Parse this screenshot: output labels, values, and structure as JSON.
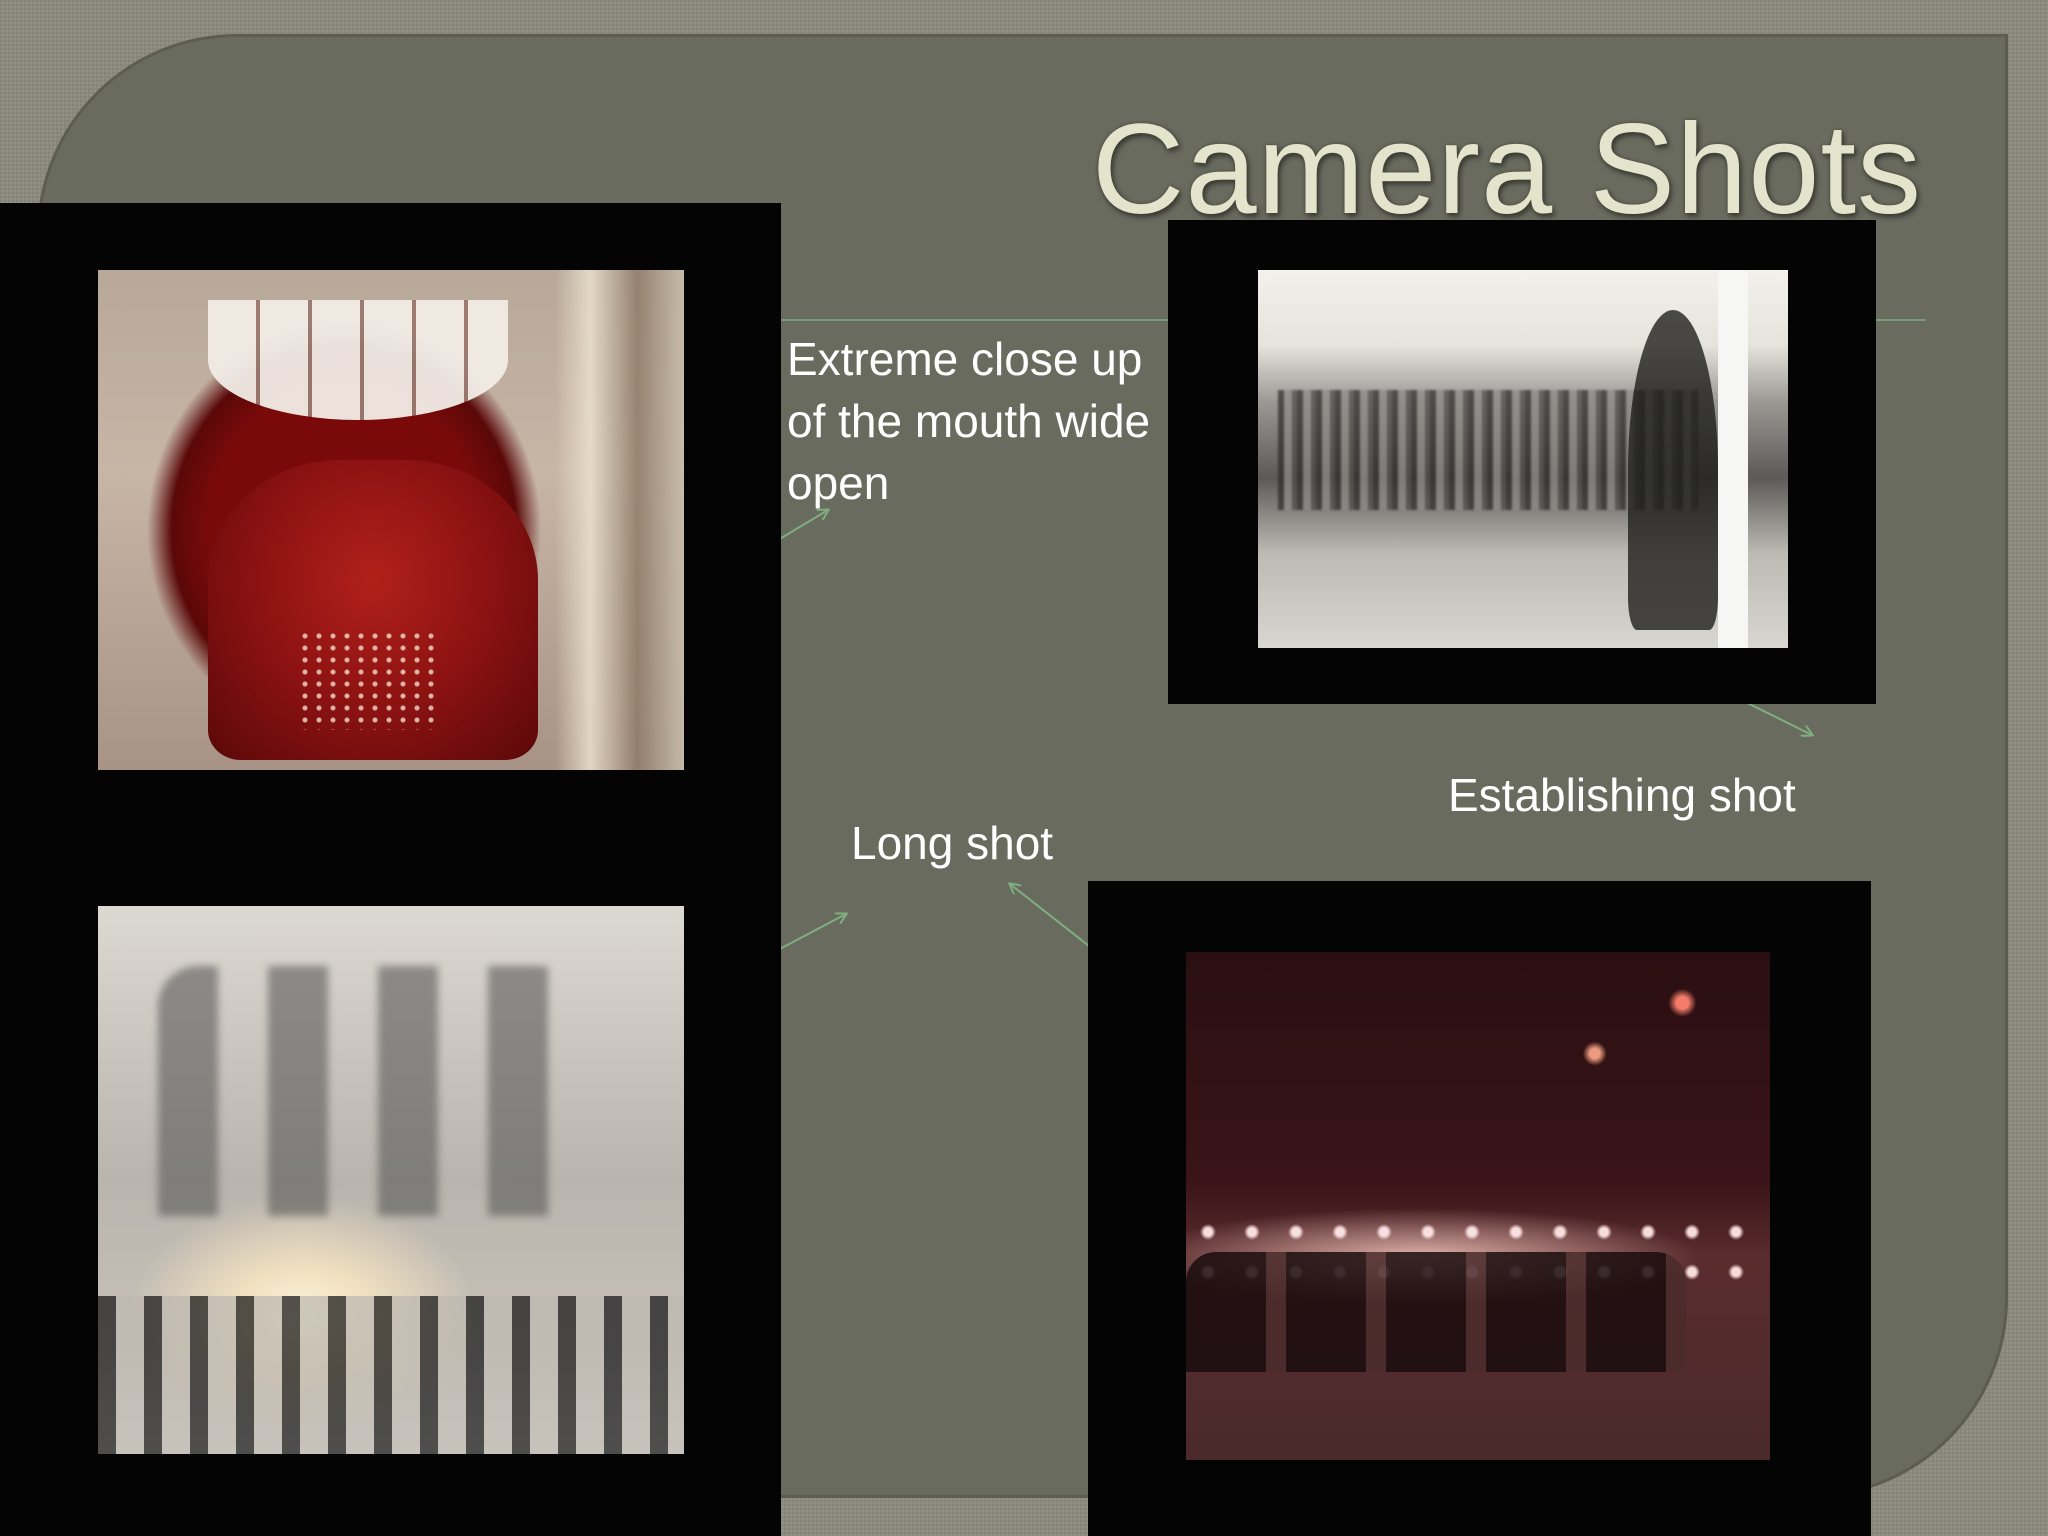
{
  "slide": {
    "title": "Camera Shots",
    "accent_color": "#7b9a78",
    "captions": {
      "extreme_close_up": "Extreme close up\nof the mouth wide\nopen",
      "establishing": "Establishing shot",
      "long": "Long shot"
    },
    "stills": [
      "mouth-close-up",
      "street-crowd",
      "smoke-figures-fire",
      "night-street-traffic"
    ]
  }
}
